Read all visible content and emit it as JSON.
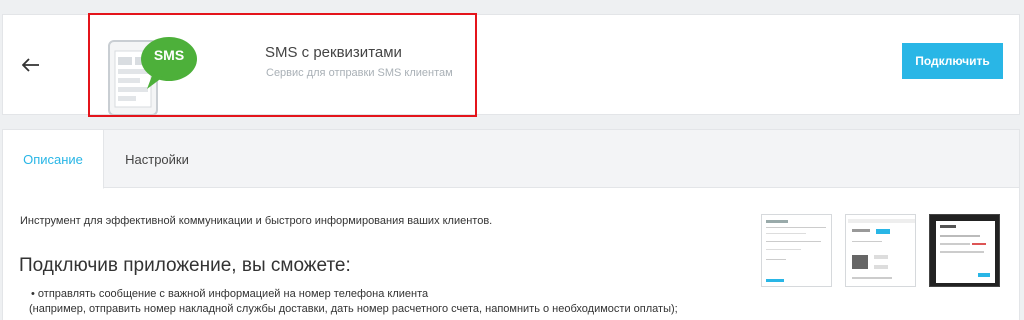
{
  "header": {
    "back_label": "←",
    "app_name": "SMS с реквизитами",
    "app_description": "Сервис для отправки SMS клиентам",
    "icon_text": "SMS",
    "connect_label": "Подключить"
  },
  "tabs": [
    {
      "label": "Описание",
      "active": true
    },
    {
      "label": "Настройки",
      "active": false
    }
  ],
  "content": {
    "intro": "Инструмент для эффективной коммуникации и быстрого информирования ваших клиентов.",
    "subheading": "Подключив приложение, вы сможете:",
    "bullets": [
      "отправлять сообщение с важной информацией на номер телефона клиента",
      "(например, отправить номер накладной службы доставки, дать номер расчетного счета, напомнить о необходимости оплаты);"
    ]
  },
  "colors": {
    "accent": "#29b6e6",
    "highlight": "#e4141b",
    "sms_badge": "#4db03a"
  },
  "icons": [
    "back-arrow-icon",
    "sms-phone-icon"
  ]
}
